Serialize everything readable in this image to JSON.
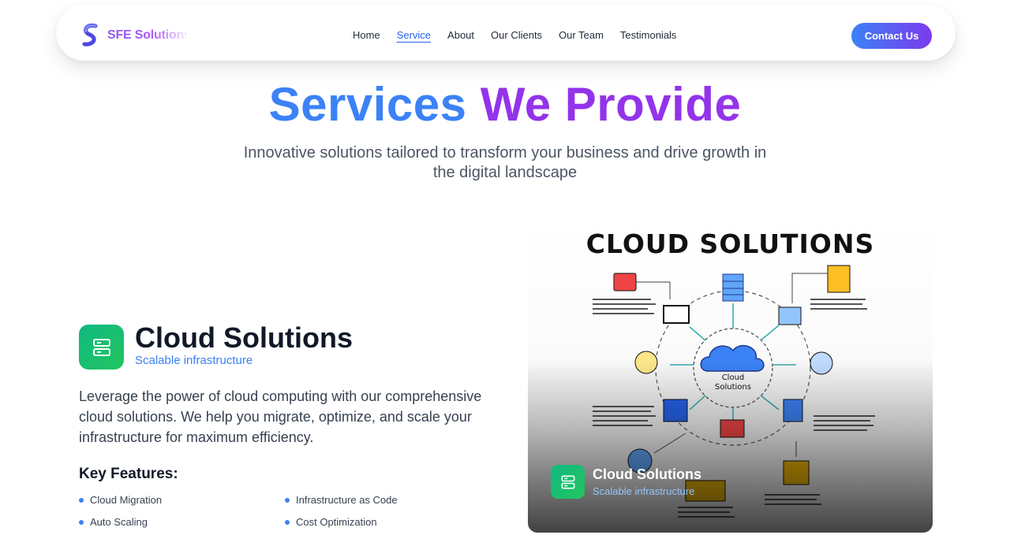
{
  "brand": {
    "name": "SFE Solutions"
  },
  "nav": {
    "links": [
      {
        "label": "Home"
      },
      {
        "label": "Service"
      },
      {
        "label": "About"
      },
      {
        "label": "Our Clients"
      },
      {
        "label": "Our Team"
      },
      {
        "label": "Testimonials"
      }
    ],
    "active_index": 1,
    "cta_label": "Contact Us"
  },
  "hero": {
    "title_part1": "Services",
    "title_part2": "We Provide",
    "subtitle": "Innovative solutions tailored to transform your business and drive growth in the digital landscape"
  },
  "service": {
    "icon": "server-icon",
    "title": "Cloud Solutions",
    "tagline": "Scalable infrastructure",
    "description": "Leverage the power of cloud computing with our comprehensive cloud solutions. We help you migrate, optimize, and scale your infrastructure for maximum efficiency.",
    "features_title": "Key Features:",
    "features": [
      "Cloud Migration",
      "Infrastructure as Code",
      "Auto Scaling",
      "Cost Optimization"
    ]
  },
  "image_card": {
    "poster_title": "CLOUD SOLUTIONS",
    "center_label": "Cloud Solutions",
    "overlay_title": "Cloud Solutions",
    "overlay_subtitle": "Scalable infrastructure"
  },
  "colors": {
    "accent_blue": "#3b82f6",
    "accent_purple": "#9333ea",
    "icon_green": "#10b981"
  }
}
